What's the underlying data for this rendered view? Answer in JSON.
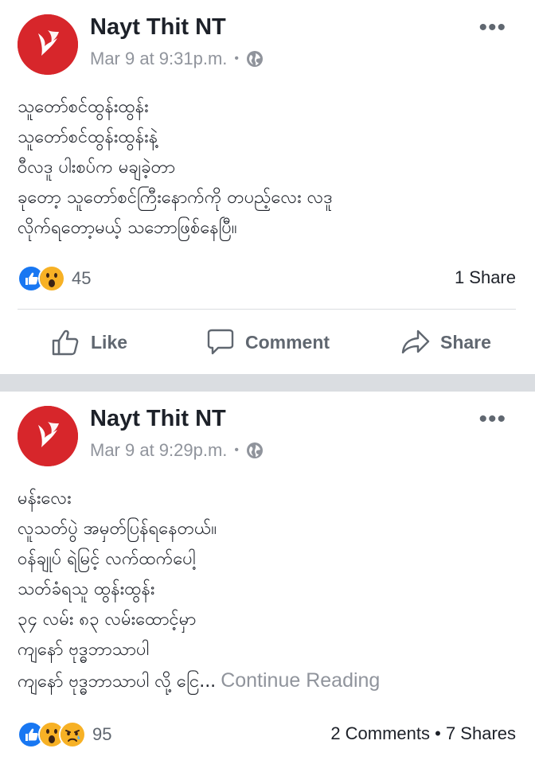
{
  "posts": [
    {
      "page_name": "Nayt Thit NT",
      "timestamp": "Mar 9 at 9:31p.m.",
      "separator": "•",
      "more": "•••",
      "lines": [
        "သူတော်စင်ထွန်းထွန်း",
        "သူတော်စင်ထွန်းထွန်းနဲ့",
        "ဝီလဒူ ပါးစပ်က မချခဲ့တာ",
        "ခုတော့ သူတော်စင်ကြီးနောက်ကို တပည့်လေး လဒူ",
        "လိုက်ရတော့မယ့် သဘောဖြစ်နေပြီ။"
      ],
      "reactions": [
        "like-reaction",
        "wow-reaction"
      ],
      "reaction_count": "45",
      "shares_text": "1 Share",
      "actions": {
        "like": "Like",
        "comment": "Comment",
        "share": "Share"
      }
    },
    {
      "page_name": "Nayt Thit NT",
      "timestamp": "Mar 9 at 9:29p.m.",
      "separator": "•",
      "more": "•••",
      "lines": [
        "မန်းလေး",
        "လူသတ်ပွဲ အမှတ်ပြန်ရနေတယ်။",
        "ဝန်ချုပ် ရဲမြင့် လက်ထက်ပေါ့",
        "သတ်ခံရသူ ထွန်းထွန်း",
        "၃၄ လမ်း ၈၃ လမ်းထောင့်မှာ",
        "ကျနော် ဗုဒ္ဓဘာသာပါ",
        "ကျနော် ဗုဒ္ဓဘာသာပါ လို့ ငြေ..."
      ],
      "continue_reading": "Continue Reading",
      "reactions": [
        "like-reaction",
        "wow-reaction",
        "sad-reaction"
      ],
      "reaction_count": "95",
      "shares_text": "2 Comments • 7 Shares"
    }
  ],
  "colors": {
    "brand_red": "#d7262b",
    "like_blue": "#1877f2",
    "wow_yellow": "#f7b125",
    "meta_gray": "#90949c",
    "separator": "#dadde1"
  }
}
